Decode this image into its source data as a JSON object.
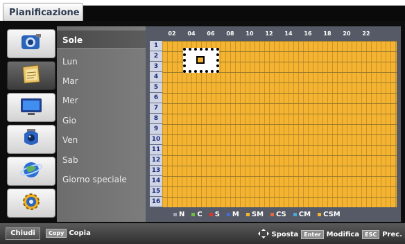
{
  "tab": {
    "title": "Pianificazione"
  },
  "sidebar": {
    "icons": [
      {
        "name": "camera-settings-icon"
      },
      {
        "name": "schedule-icon",
        "selected": true
      },
      {
        "name": "monitor-icon"
      },
      {
        "name": "dome-camera-icon"
      },
      {
        "name": "network-icon"
      },
      {
        "name": "system-gear-icon"
      }
    ]
  },
  "days": [
    {
      "label": "Sole",
      "selected": true
    },
    {
      "label": "Lun"
    },
    {
      "label": "Mar"
    },
    {
      "label": "Mer"
    },
    {
      "label": "Gio"
    },
    {
      "label": "Ven"
    },
    {
      "label": "Sab"
    },
    {
      "label": "Giorno speciale"
    }
  ],
  "grid": {
    "hours": [
      "02",
      "04",
      "06",
      "08",
      "10",
      "12",
      "14",
      "16",
      "18",
      "20",
      "22"
    ],
    "rows": [
      "1",
      "2",
      "3",
      "4",
      "5",
      "6",
      "7",
      "8",
      "9",
      "10",
      "11",
      "12",
      "13",
      "14",
      "15",
      "16"
    ],
    "fill_color": "#f4b331"
  },
  "legend": [
    {
      "label": "N",
      "color": "#9aa3b5"
    },
    {
      "label": "C",
      "color": "#6fbe3b"
    },
    {
      "label": "S",
      "color": "#e0342b"
    },
    {
      "label": "M",
      "color": "#3f6fd0"
    },
    {
      "label": "SM",
      "color": "#f4b331"
    },
    {
      "label": "CS",
      "color": "#e06a3a"
    },
    {
      "label": "CM",
      "color": "#4aa6d8"
    },
    {
      "label": "CSM",
      "color": "#f4b331"
    }
  ],
  "bottom": {
    "chiudi": "Chiudi",
    "copy_key": "Copy",
    "copia": "Copia",
    "sposta": "Sposta",
    "enter_key": "Enter",
    "modifica": "Modifica",
    "esc_key": "ESC",
    "prec": "Prec."
  }
}
